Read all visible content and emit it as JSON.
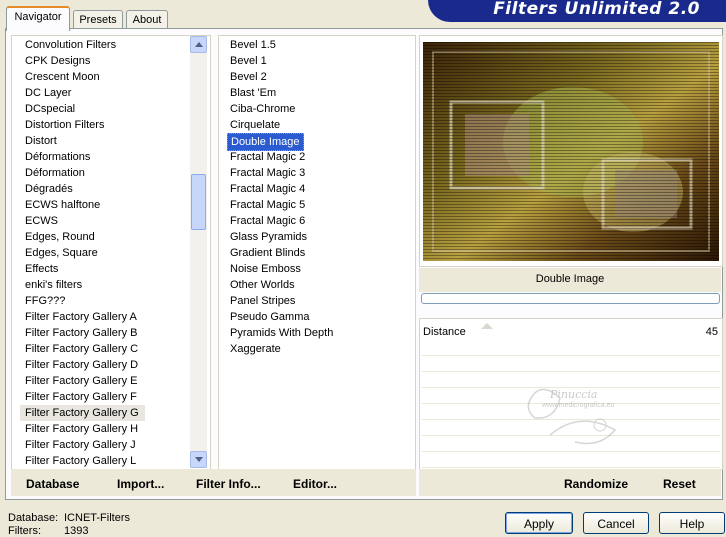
{
  "tabs": [
    {
      "label": "Navigator",
      "active": true
    },
    {
      "label": "Presets",
      "active": false
    },
    {
      "label": "About",
      "active": false
    }
  ],
  "banner": "Filters Unlimited 2.0",
  "categories": [
    "Convolution Filters",
    "CPK Designs",
    "Crescent Moon",
    "DC Layer",
    "DCspecial",
    "Distortion Filters",
    "Distort",
    "Déformations",
    "Déformation",
    "Dégradés",
    "ECWS halftone",
    "ECWS",
    "Edges, Round",
    "Edges, Square",
    "Effects",
    "enki's filters",
    "FFG???",
    "Filter Factory Gallery A",
    "Filter Factory Gallery B",
    "Filter Factory Gallery C",
    "Filter Factory Gallery D",
    "Filter Factory Gallery E",
    "Filter Factory Gallery F",
    "Filter Factory Gallery G",
    "Filter Factory Gallery H",
    "Filter Factory Gallery J",
    "Filter Factory Gallery L"
  ],
  "selected_category": "Filter Factory Gallery G",
  "filters": [
    "Bevel 1.5",
    "Bevel 1",
    "Bevel 2",
    "Blast 'Em",
    "Ciba-Chrome",
    "Cirquelate",
    "Double Image",
    "Fractal Magic 2",
    "Fractal Magic 3",
    "Fractal Magic 4",
    "Fractal Magic 5",
    "Fractal Magic 6",
    "Glass Pyramids",
    "Gradient Blinds",
    "Noise Emboss",
    "Other Worlds",
    "Panel Stripes",
    "Pseudo Gamma",
    "Pyramids With Depth",
    "Xaggerate"
  ],
  "selected_filter": "Double Image",
  "preview": {
    "filter_name": "Double Image",
    "progress": 0
  },
  "param": {
    "name": "Distance",
    "value": "45"
  },
  "watermark": {
    "line1": "Pinuccia",
    "line2": "www.medicrografica.eu"
  },
  "commands": {
    "database": "Database",
    "import": "Import...",
    "filter_info": "Filter Info...",
    "editor": "Editor...",
    "randomize": "Randomize",
    "reset": "Reset"
  },
  "status": {
    "database_label": "Database:",
    "database_value": "ICNET-Filters",
    "filters_label": "Filters:",
    "filters_value": "1393"
  },
  "buttons": {
    "apply": "Apply",
    "cancel": "Cancel",
    "help": "Help"
  },
  "colors": {
    "selection": "#2a5bd0",
    "banner": "#1a2a8c",
    "tab_highlight": "#e68b2c"
  }
}
